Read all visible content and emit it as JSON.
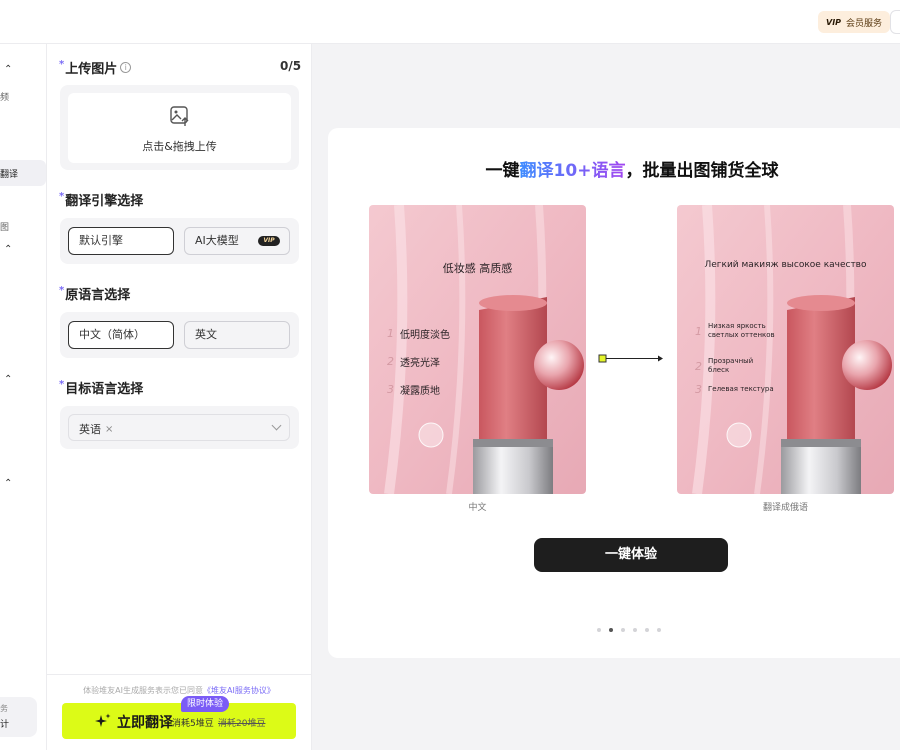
{
  "topbar": {
    "vip_mark": "VIP",
    "vip_label": "会员服务"
  },
  "leftnav": {
    "frag_1": "频",
    "active_label": "翻译",
    "frag_2": "图",
    "bottom_small": "务",
    "bottom_main": "计"
  },
  "upload": {
    "title": "上传图片",
    "count": "0/5",
    "hint": "点击&拖拽上传"
  },
  "engine": {
    "title": "翻译引擎选择",
    "options": [
      {
        "label": "默认引擎",
        "selected": true
      },
      {
        "label": "AI大模型",
        "selected": false,
        "tag": "VIP"
      }
    ]
  },
  "source_lang": {
    "title": "原语言选择",
    "options": [
      {
        "label": "中文（简体）",
        "selected": true
      },
      {
        "label": "英文",
        "selected": false
      }
    ]
  },
  "target_lang": {
    "title": "目标语言选择",
    "selected_tags": [
      "英语"
    ]
  },
  "footer": {
    "agree_text": "体验堆友AI生成服务表示您已同意",
    "agree_link": "《堆友AI服务协议》",
    "button_label": "立即翻译",
    "cost": "消耗5堆豆",
    "cost_old": "消耗20堆豆",
    "badge": "限时体验"
  },
  "preview": {
    "headline_pre": "一键",
    "headline_highlight": "翻译10+语言",
    "headline_post": "，批量出图铺货全球",
    "left": {
      "title": "低妆感 高质感",
      "items": [
        {
          "num": "1",
          "text": "低明度淡色"
        },
        {
          "num": "2",
          "text": "透亮光泽"
        },
        {
          "num": "3",
          "text": "凝露质地"
        }
      ],
      "caption": "中文"
    },
    "right": {
      "title": "Легкий макияж   высокое качество",
      "items": [
        {
          "num": "1",
          "text": "Низкая яркость светлых оттенков"
        },
        {
          "num": "2",
          "text": "Прозрачный блеск"
        },
        {
          "num": "3",
          "text": "Гелевая текстура"
        }
      ],
      "caption": "翻译成俄语"
    },
    "try_button": "一键体验",
    "carousel": {
      "count": 6,
      "active": 2
    }
  },
  "colors": {
    "accent": "#7b6cf6",
    "cta": "#dcfb17",
    "dark": "#1e1e1e"
  }
}
